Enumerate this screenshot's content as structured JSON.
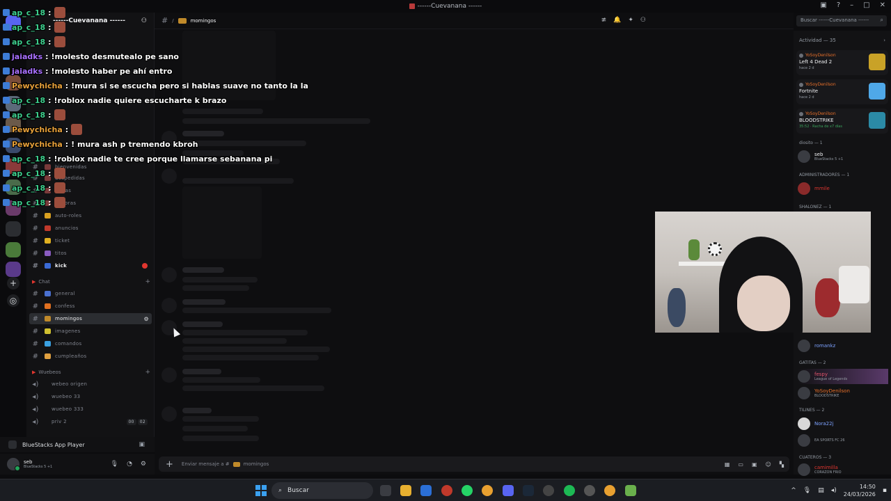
{
  "window": {
    "title": "------Cuevanana ------"
  },
  "server": {
    "name": "------Cuevanana ------"
  },
  "sidebar": {
    "channels_top": [
      {
        "label": "bienvenidas"
      },
      {
        "label": "despedidas"
      },
      {
        "label": "reglas"
      },
      {
        "label": "mejoras"
      },
      {
        "label": "auto-roles"
      },
      {
        "label": "anuncios"
      },
      {
        "label": "ticket"
      },
      {
        "label": "titos"
      },
      {
        "label": "kick"
      }
    ],
    "category_chat": "Chat",
    "channels_chat": [
      {
        "label": "general"
      },
      {
        "label": "confess"
      },
      {
        "label": "momingos"
      },
      {
        "label": "imagenes"
      },
      {
        "label": "comandos"
      },
      {
        "label": "cumpleaños"
      }
    ],
    "category_voice": "Wuebeos",
    "voice_channels": [
      {
        "label": "webeo origen"
      },
      {
        "label": "wuebeo 33"
      },
      {
        "label": "wuebeo 333"
      },
      {
        "label": "priv 2"
      }
    ],
    "voice_counts": [
      "00",
      "02"
    ]
  },
  "activity_bar": {
    "label": "BlueStacks App Player"
  },
  "user_panel": {
    "name": "seb",
    "status": "BlueStacks 5 +1"
  },
  "channel_header": {
    "name": "momingos"
  },
  "search": {
    "placeholder": "Buscar ------Cuevanana ------"
  },
  "composer": {
    "placeholder": "Enviar mensaje a #",
    "channel": "momingos"
  },
  "members": {
    "activity_title": "Actividad — 35",
    "activity_cards": [
      {
        "user": "YoSoyDenilson",
        "game": "Left 4 Dead 2",
        "meta": "hace 2 d",
        "color": "#c9a227"
      },
      {
        "user": "YoSoyDenilson",
        "game": "Fortnite",
        "meta": "hace 2 d",
        "color": "#4fa8e8"
      },
      {
        "user": "YoSoyDenilson",
        "game": "BLOODSTRIKE",
        "meta": "35:52 · Racha de x7 días",
        "color": "#2b8aa6"
      }
    ],
    "groups": [
      {
        "title": "diosito — 1"
      },
      {
        "title": "ADMINISTRADORES — 1"
      },
      {
        "title": "SHALONEZ — 1"
      },
      {
        "title": "GATITAS — 2"
      },
      {
        "title": "TILINES — 2"
      },
      {
        "title": "CUATEROS — 3"
      }
    ],
    "list": [
      {
        "name": "seb",
        "status": "BlueStacks 5 +1",
        "color": "#f2f3f5"
      },
      {
        "name": "mmile",
        "status": "",
        "color": "#e0362f"
      },
      {
        "name": "romankz",
        "status": "",
        "color": "#7da2ff"
      },
      {
        "name": "fespy",
        "status": "League of Legends",
        "color": "#e2546b"
      },
      {
        "name": "YoSoyDenilson",
        "status": "BLOODSTRIKE",
        "color": "#e8702a"
      },
      {
        "name": "Nora22j",
        "status": "",
        "color": "#7da2ff"
      },
      {
        "name": "",
        "status": "EA SPORTS FC 26",
        "color": "#f2f3f5"
      },
      {
        "name": "camimilla",
        "status": "CORAZON FRIO",
        "color": "#e0362f"
      }
    ]
  },
  "stream_chat": [
    {
      "user": "ap_c_18",
      "text": "",
      "color": "#3ecf8e",
      "emote": true
    },
    {
      "user": "ap_c_18",
      "text": "",
      "color": "#3ecf8e",
      "emote": true
    },
    {
      "user": "ap_c_18",
      "text": "",
      "color": "#3ecf8e",
      "emote": true
    },
    {
      "user": "jaiadks",
      "text": "!molesto desmutealo pe sano",
      "color": "#a970ff",
      "emote": false
    },
    {
      "user": "jaiadks",
      "text": "!molesto haber pe ahí entro",
      "color": "#a970ff",
      "emote": false
    },
    {
      "user": "Pewychicha",
      "text": "!mura si se escucha pero si hablas suave no tanto la la",
      "color": "#e8a13a",
      "emote": false
    },
    {
      "user": "ap_c_18",
      "text": "!roblox nadie quiere escucharte k brazo",
      "color": "#3ecf8e",
      "emote": false
    },
    {
      "user": "ap_c_18",
      "text": "",
      "color": "#3ecf8e",
      "emote": true
    },
    {
      "user": "Pewychicha",
      "text": "",
      "color": "#e8a13a",
      "emote": true
    },
    {
      "user": "Pewychicha",
      "text": "! mura ash p tremendo kbroh",
      "color": "#e8a13a",
      "emote": false
    },
    {
      "user": "ap_c_18",
      "text": "!roblox nadie te cree porque llamarse sebanana pi",
      "color": "#3ecf8e",
      "emote": false
    },
    {
      "user": "ap_c_18",
      "text": "",
      "color": "#3ecf8e",
      "emote": true
    },
    {
      "user": "ap_c_18",
      "text": "",
      "color": "#3ecf8e",
      "emote": true
    },
    {
      "user": "ap_c_18",
      "text": "",
      "color": "#3ecf8e",
      "emote": true
    }
  ],
  "taskbar": {
    "search_label": "Buscar",
    "time": "14:50",
    "date": "24/03/2026"
  }
}
